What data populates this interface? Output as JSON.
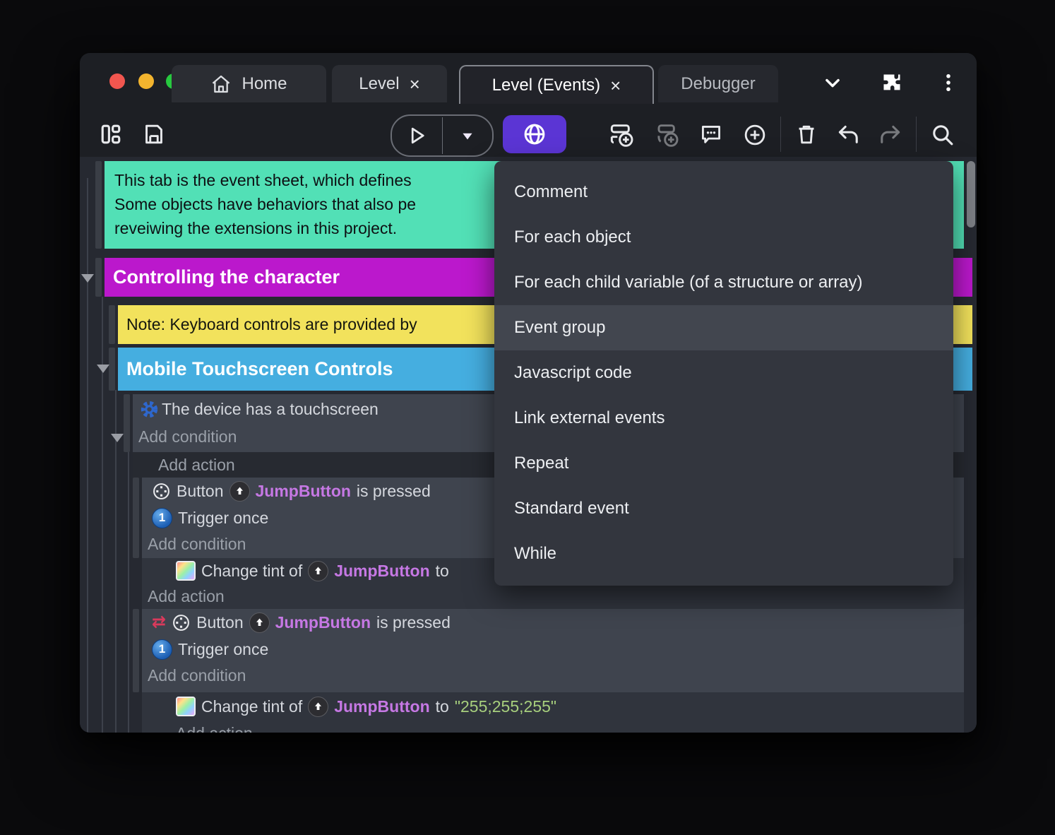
{
  "tabs": {
    "home": "Home",
    "level": "Level",
    "level_events": "Level (Events)",
    "debugger": "Debugger",
    "close_glyph": "×"
  },
  "menu": {
    "items": [
      {
        "label": "Comment"
      },
      {
        "label": "For each object"
      },
      {
        "label": "For each child variable (of a structure or array)"
      },
      {
        "label": "Event group",
        "highlighted": true
      },
      {
        "label": "Javascript code"
      },
      {
        "label": "Link external events"
      },
      {
        "label": "Repeat"
      },
      {
        "label": "Standard event"
      },
      {
        "label": "While"
      }
    ]
  },
  "sheet": {
    "comment_line1": "This tab is the event sheet, which defines",
    "comment_line2": "Some objects have behaviors that also pe",
    "comment_line3": "reveiwing the extensions in this project.",
    "group_controlling": "Controlling the character",
    "note": "Note: Keyboard controls are provided by",
    "group_mobile": "Mobile Touchscreen Controls",
    "cond_touchscreen": "The device has a touchscreen",
    "add_condition": "Add condition",
    "add_action": "Add action",
    "button_label": "Button",
    "object_name": "JumpButton",
    "is_pressed": "is pressed",
    "trigger_once": "Trigger once",
    "change_tint_of": "Change tint of",
    "to_word": "to",
    "tint_value": "\"255;255;255\"",
    "invert_glyph": "⇄",
    "once_glyph": "1"
  },
  "colors": {
    "comment_teal": "#52e0b6",
    "group_magenta": "#bb18cc",
    "note_yellow": "#f2e25c",
    "group_blue": "#45aee0",
    "accent_purple": "#5b35d4",
    "object_purple": "#c678e4",
    "string_green": "#a7cf7d",
    "traffic_red": "#f1564f",
    "traffic_yellow": "#f3b42e",
    "traffic_green": "#27c93f"
  }
}
